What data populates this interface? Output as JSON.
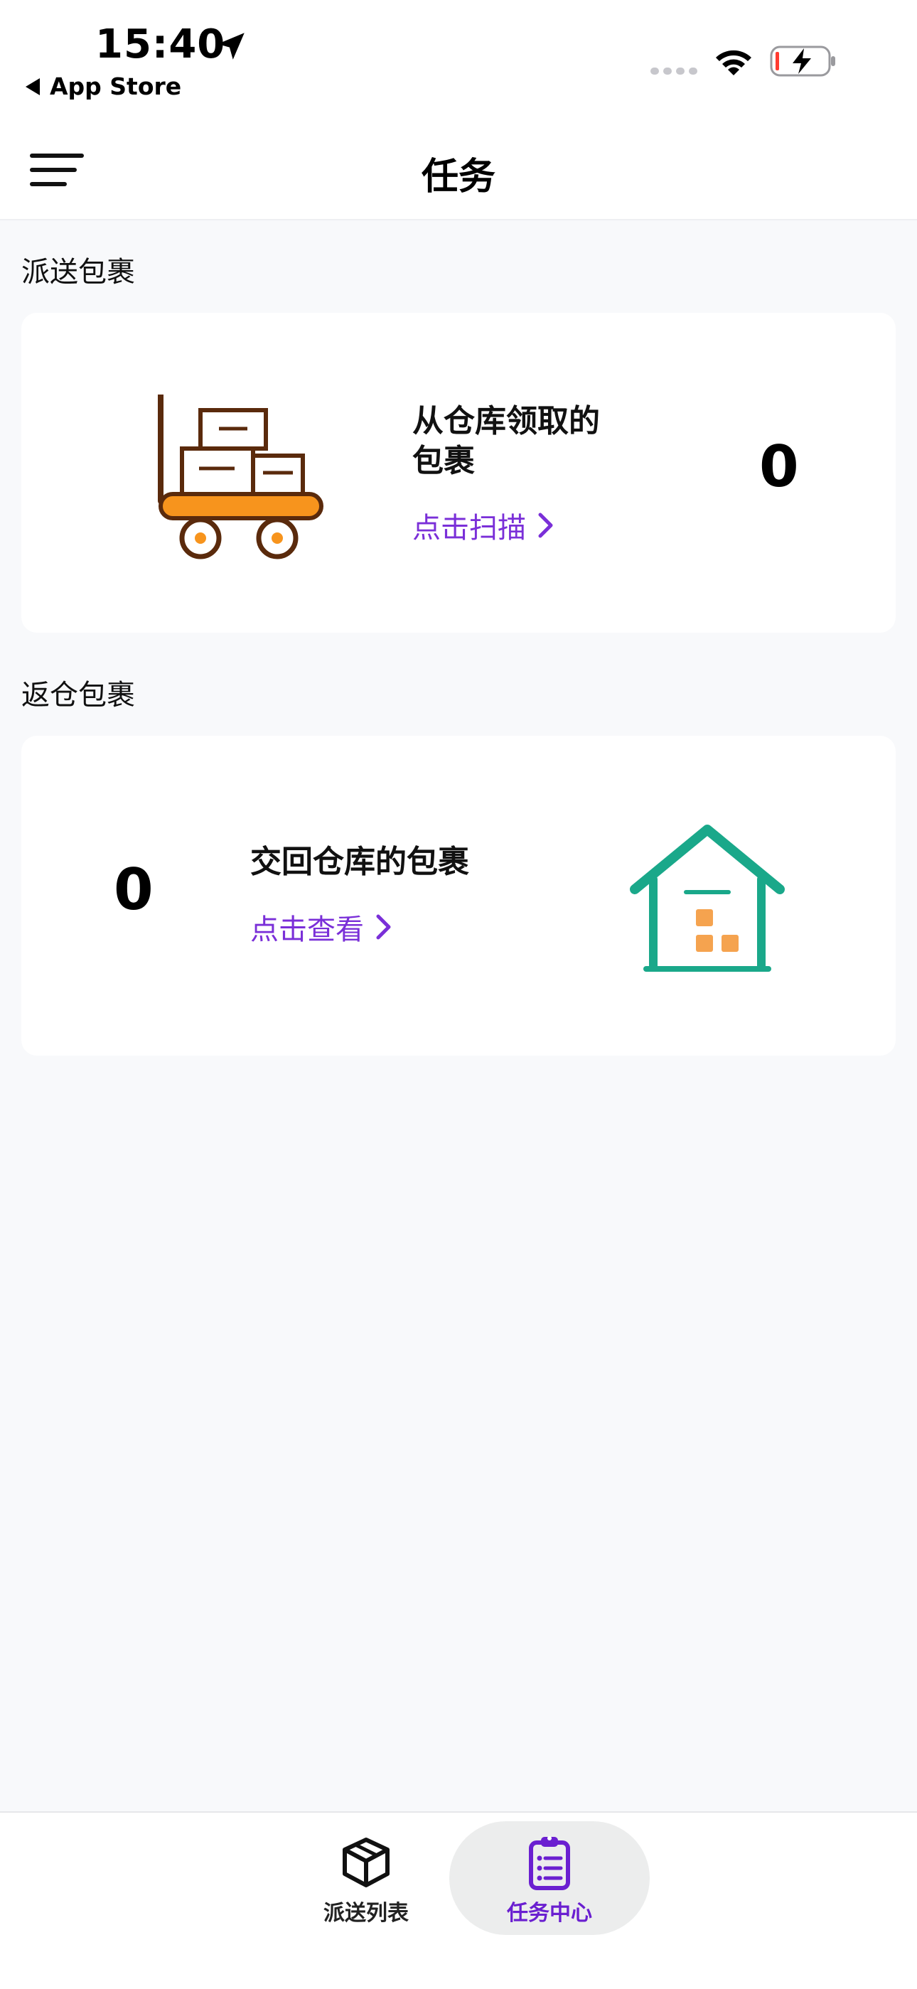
{
  "status_bar": {
    "time": "15:40",
    "back_label": "App Store"
  },
  "nav": {
    "title": "任务"
  },
  "sections": {
    "delivery": {
      "label": "派送包裹",
      "title_line1": "从仓库领取的",
      "title_line2": "包裹",
      "link": "点击扫描",
      "count": "0"
    },
    "return": {
      "label": "返仓包裹",
      "title": "交回仓库的包裹",
      "link": "点击查看",
      "count": "0"
    }
  },
  "tabs": [
    {
      "label": "派送列表",
      "icon": "package-icon",
      "active": false
    },
    {
      "label": "任务中心",
      "icon": "clipboard-list-icon",
      "active": true
    }
  ],
  "colors": {
    "accent": "#7a2fd8",
    "cart_orange": "#f7941d",
    "cart_brown": "#5a2a0c",
    "warehouse_green": "#1aa88a",
    "box_orange": "#f5a34f"
  }
}
